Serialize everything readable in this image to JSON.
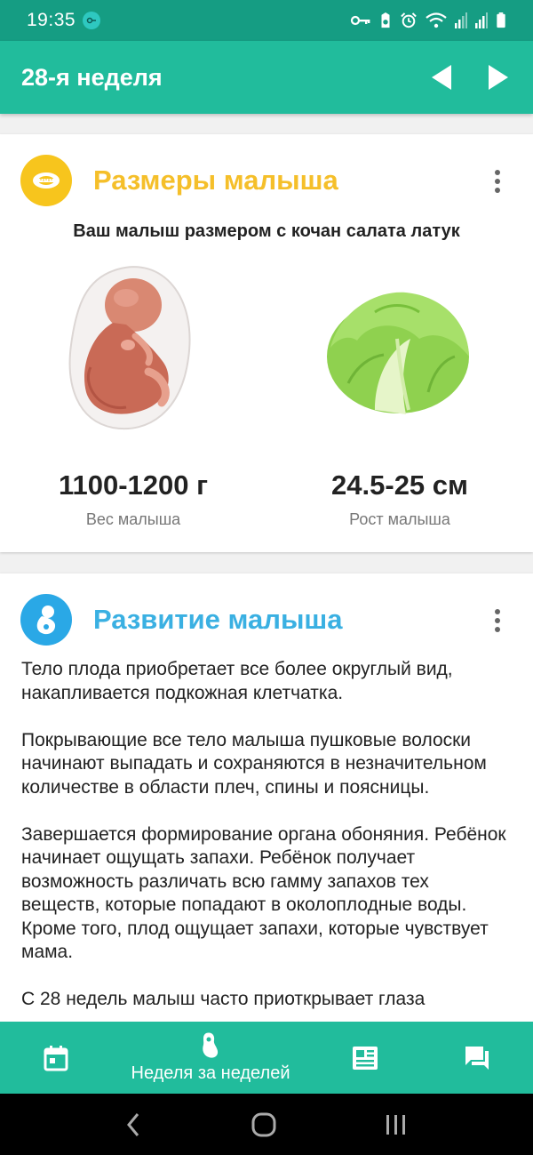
{
  "status_bar": {
    "time": "19:35"
  },
  "app_bar": {
    "title": "28-я неделя"
  },
  "size_card": {
    "title": "Размеры малыша",
    "title_color": "#f5bf2a",
    "icon_color": "#f7c51d",
    "subtitle": "Ваш малыш размером с кочан салата латук",
    "weight_value": "1100-1200 г",
    "weight_label": "Вес малыша",
    "height_value": "24.5-25 см",
    "height_label": "Рост малыша"
  },
  "dev_card": {
    "title": "Развитие малыша",
    "title_color": "#3ab0e2",
    "icon_color": "#2aa8e6",
    "paragraphs": [
      "Тело плода приобретает все более округлый вид, накапливается подкожная клетчатка.",
      "Покрывающие все тело малыша пушковые волоски начинают выпадать и сохраняются в незначительном количестве в области плеч, спины и поясницы.",
      "Завершается формирование органа обоняния. Ребёнок начинает ощущать запахи. Ребёнок получает возможность различать всю гамму запахов тех веществ, которые попадают в околоплодные воды. Кроме того, плод ощущает запахи, которые чувствует мама.",
      "С 28 недель малыш часто приоткрывает глаза"
    ]
  },
  "bottom_nav": {
    "items": [
      {
        "icon": "calendar-icon"
      },
      {
        "icon": "baby-foot-icon",
        "label": "Неделя за неделей"
      },
      {
        "icon": "article-icon"
      },
      {
        "icon": "chat-icon"
      }
    ]
  },
  "colors": {
    "primary": "#21bc9c",
    "primary_dark": "#159d83"
  }
}
